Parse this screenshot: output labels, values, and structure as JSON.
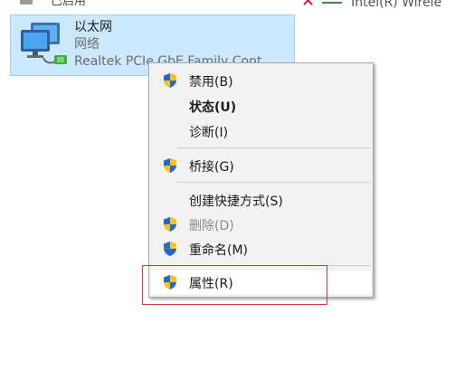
{
  "top_partial": {
    "left_text": "已启用",
    "right_text": "Intel(R) Wirele"
  },
  "adapter": {
    "name": "以太网",
    "network": "网络",
    "device": "Realtek PCIe GbE Family Cont"
  },
  "context_menu": {
    "items": [
      {
        "label": "禁用(B)",
        "icon": "uac-shield-icon"
      },
      {
        "label": "状态(U)"
      },
      {
        "label": "诊断(I)"
      },
      {
        "label": "桥接(G)",
        "icon": "uac-shield-icon"
      },
      {
        "label": "创建快捷方式(S)"
      },
      {
        "label": "删除(D)",
        "icon": "uac-shield-icon"
      },
      {
        "label": "重命名(M)",
        "icon": "uac-shield-icon"
      },
      {
        "label": "属性(R)",
        "icon": "uac-shield-icon"
      }
    ]
  },
  "colors": {
    "selection_bg": "#cce8ff",
    "selection_border": "#99d1ff",
    "menu_bg": "#f2f2f2",
    "highlight_red": "#d8343a"
  }
}
